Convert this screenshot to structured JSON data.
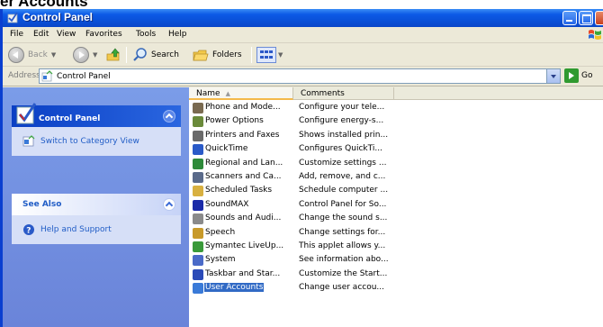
{
  "page_heading": "er Accounts",
  "window": {
    "title": "Control Panel",
    "menu": [
      "File",
      "Edit",
      "View",
      "Favorites",
      "Tools",
      "Help"
    ],
    "toolbar": {
      "back": "Back",
      "search": "Search",
      "folders": "Folders"
    },
    "address": {
      "label": "Address",
      "value": "Control Panel",
      "go": "Go"
    }
  },
  "taskpane": {
    "control_panel": {
      "title": "Control Panel",
      "links": [
        "Switch to Category View"
      ]
    },
    "see_also": {
      "title": "See Also",
      "links": [
        "Help and Support"
      ]
    }
  },
  "list": {
    "columns": [
      "Name",
      "Comments"
    ],
    "rows": [
      {
        "name": "Phone and Mode...",
        "comment": "Configure your tele...",
        "icon": "phone-modem-icon",
        "color": "#7a6a50"
      },
      {
        "name": "Power Options",
        "comment": "Configure energy-s...",
        "icon": "power-options-icon",
        "color": "#6a8a3a"
      },
      {
        "name": "Printers and Faxes",
        "comment": "Shows installed prin...",
        "icon": "printer-icon",
        "color": "#6a6a6a"
      },
      {
        "name": "QuickTime",
        "comment": "Configures QuickTi...",
        "icon": "quicktime-icon",
        "color": "#2a5ac8"
      },
      {
        "name": "Regional and Lan...",
        "comment": "Customize settings ...",
        "icon": "globe-icon",
        "color": "#2e8a3a"
      },
      {
        "name": "Scanners and Ca...",
        "comment": "Add, remove, and c...",
        "icon": "scanner-camera-icon",
        "color": "#5a6a8a"
      },
      {
        "name": "Scheduled Tasks",
        "comment": "Schedule computer ...",
        "icon": "scheduled-tasks-icon",
        "color": "#d8b040"
      },
      {
        "name": "SoundMAX",
        "comment": "Control Panel for So...",
        "icon": "soundmax-icon",
        "color": "#1a2aa8"
      },
      {
        "name": "Sounds and Audi...",
        "comment": "Change the sound s...",
        "icon": "speaker-icon",
        "color": "#8a8a8a"
      },
      {
        "name": "Speech",
        "comment": "Change settings for...",
        "icon": "speech-icon",
        "color": "#c89a2a"
      },
      {
        "name": "Symantec LiveUp...",
        "comment": "This applet allows y...",
        "icon": "symantec-icon",
        "color": "#3a9a3a"
      },
      {
        "name": "System",
        "comment": "See information abo...",
        "icon": "system-icon",
        "color": "#4a6ac8"
      },
      {
        "name": "Taskbar and Star...",
        "comment": "Customize the Start...",
        "icon": "taskbar-icon",
        "color": "#2a4ab8"
      },
      {
        "name": "User Accounts",
        "comment": "Change user accou...",
        "icon": "user-accounts-icon",
        "color": "#3a7ad8"
      }
    ],
    "selected_index": 13
  }
}
